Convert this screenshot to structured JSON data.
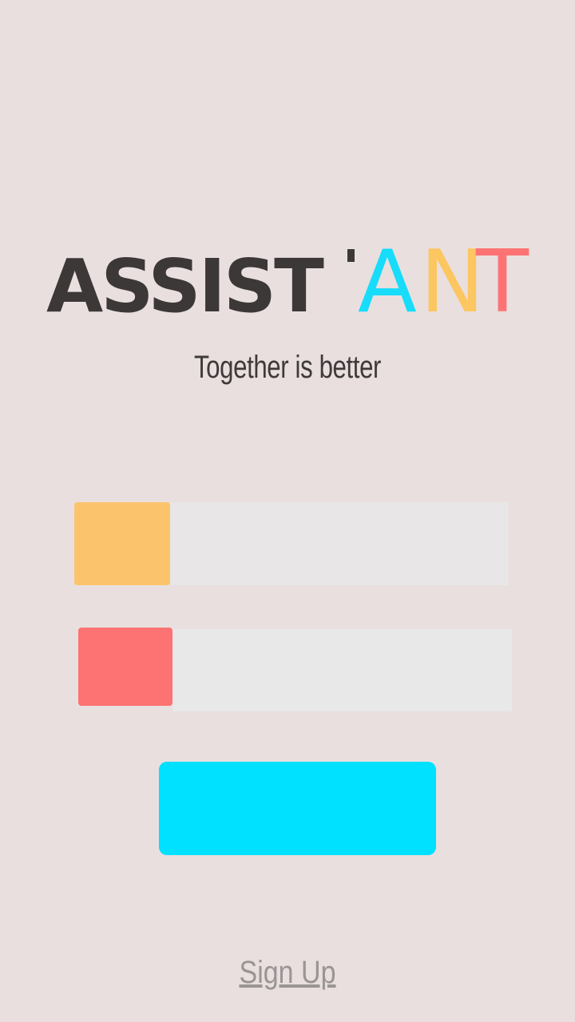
{
  "logo": {
    "bold_part": "ASSIST",
    "thin_letters": [
      "A",
      "N",
      "T"
    ],
    "colors": {
      "bold": "#3d3838",
      "thin": [
        "#17dcfa",
        "#fcc660",
        "#fd7373"
      ]
    }
  },
  "tagline": "Together is better",
  "form": {
    "username": {
      "icon": "user-icon",
      "icon_color": "#fbc46c",
      "value": "",
      "placeholder": ""
    },
    "password": {
      "icon": "lock-icon",
      "icon_color": "#fd7272",
      "value": "",
      "placeholder": ""
    },
    "login_button": {
      "label": "",
      "color": "#00e0ff"
    }
  },
  "signup_link": "Sign Up",
  "background_color": "#e9dfdf"
}
